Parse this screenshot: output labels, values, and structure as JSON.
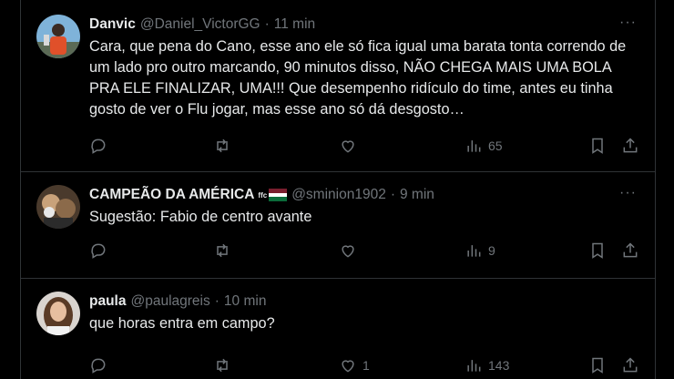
{
  "tweets": [
    {
      "name": "Danvic",
      "handle": "@Daniel_VictorGG",
      "separator": "·",
      "time": "11 min",
      "text": "Cara, que pena do Cano, esse ano ele só fica igual uma barata tonta correndo de um lado pro outro marcando, 90 minutos disso, NÃO CHEGA MAIS UMA BOLA PRA ELE FINALIZAR, UMA!!! Que desempenho ridículo do time, antes eu tinha gosto de ver o Flu jogar, mas esse ano só dá desgosto…",
      "replies": "",
      "retweets": "",
      "likes": "",
      "views": "65",
      "more": "···"
    },
    {
      "name": "CAMPEÃO DA AMÉRICA",
      "flag_text": "ffc",
      "handle": "@sminion1902",
      "separator": "·",
      "time": "9 min",
      "text": "Sugestão: Fabio de centro avante",
      "replies": "",
      "retweets": "",
      "likes": "",
      "views": "9",
      "more": "···"
    },
    {
      "name": "paula",
      "handle": "@paulagreis",
      "separator": "·",
      "time": "10 min",
      "text": "que horas entra em campo?",
      "replies": "",
      "retweets": "",
      "likes": "1",
      "views": "143",
      "more": ""
    }
  ],
  "icons": {
    "reply": "reply-icon",
    "retweet": "retweet-icon",
    "like": "heart-icon",
    "views": "views-icon",
    "bookmark": "bookmark-icon",
    "share": "share-icon",
    "more": "more-icon"
  },
  "colors": {
    "background": "#000000",
    "text": "#e7e9ea",
    "muted": "#71767b",
    "border": "#2f3336"
  }
}
